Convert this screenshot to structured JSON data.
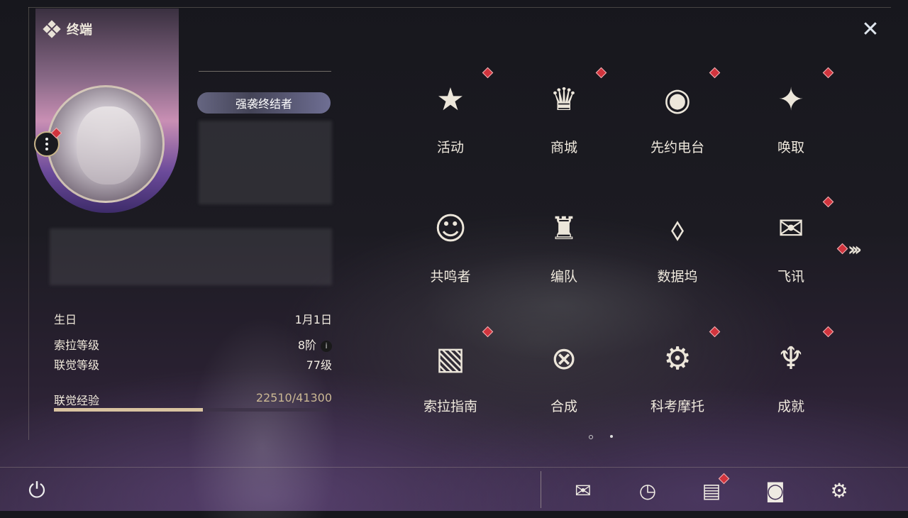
{
  "header": {
    "section_title": "终端"
  },
  "profile": {
    "title": "强袭终结者",
    "stats": [
      {
        "label": "生日",
        "value": "1月1日"
      },
      {
        "label": "索拉等级",
        "value": "8阶"
      },
      {
        "label": "联觉等级",
        "value": "77级"
      },
      {
        "label": "联觉经验",
        "value": "22510/41300"
      }
    ],
    "exp_progress": 0.545
  },
  "menu": [
    {
      "label": "活动",
      "icon": "events-2hd-icon",
      "glyph": "★",
      "badge": true
    },
    {
      "label": "商城",
      "icon": "shop-cart-icon",
      "glyph": "♛",
      "badge": true
    },
    {
      "label": "先约电台",
      "icon": "radio-icon",
      "glyph": "◉",
      "badge": true
    },
    {
      "label": "唤取",
      "icon": "convene-compass-icon",
      "glyph": "✦",
      "badge": true
    },
    {
      "label": "共鸣者",
      "icon": "resonator-head-icon",
      "glyph": "☺",
      "badge": false
    },
    {
      "label": "编队",
      "icon": "chess-team-icon",
      "glyph": "♜",
      "badge": false
    },
    {
      "label": "数据坞",
      "icon": "data-bank-icon",
      "glyph": "⬨",
      "badge": false
    },
    {
      "label": "飞讯",
      "icon": "message-icon",
      "glyph": "✉",
      "badge": true
    },
    {
      "label": "索拉指南",
      "icon": "guide-book-icon",
      "glyph": "▧",
      "badge": true
    },
    {
      "label": "合成",
      "icon": "synthesis-icon",
      "glyph": "⊗",
      "badge": false
    },
    {
      "label": "科考摩托",
      "icon": "motorcycle-icon",
      "glyph": "⚙",
      "badge": true
    },
    {
      "label": "成就",
      "icon": "trophy-icon",
      "glyph": "♆",
      "badge": true
    }
  ],
  "pager": {
    "pages": 2,
    "current": 1
  },
  "bottom_bar": [
    {
      "name": "mail",
      "glyph": "✉",
      "badge": false
    },
    {
      "name": "clock",
      "glyph": "◷",
      "badge": false
    },
    {
      "name": "notice",
      "glyph": "▤",
      "badge": true
    },
    {
      "name": "camera",
      "glyph": "◙",
      "badge": false
    },
    {
      "name": "settings",
      "glyph": "⚙",
      "badge": false
    }
  ],
  "colors": {
    "accent": "#d9c3a0",
    "badge": "#d1343d"
  }
}
